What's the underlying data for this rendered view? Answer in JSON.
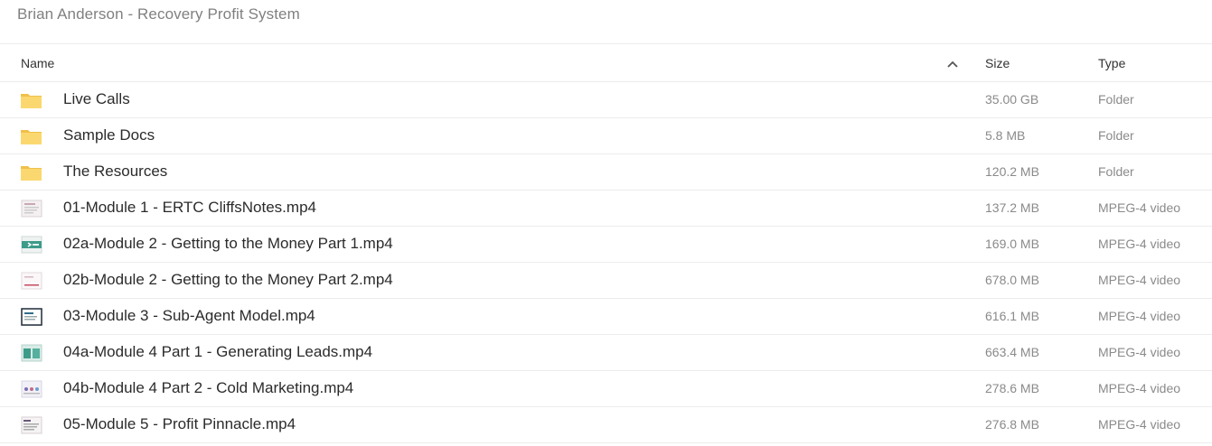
{
  "folder_title": "Brian Anderson - Recovery Profit System",
  "columns": {
    "name": "Name",
    "size": "Size",
    "type": "Type",
    "sort_icon": "chevron-up-icon"
  },
  "files": [
    {
      "name": "Live Calls",
      "size": "35.00 GB",
      "type": "Folder",
      "icon": "folder-icon"
    },
    {
      "name": "Sample Docs",
      "size": "5.8 MB",
      "type": "Folder",
      "icon": "folder-icon"
    },
    {
      "name": "The Resources",
      "size": "120.2 MB",
      "type": "Folder",
      "icon": "folder-icon"
    },
    {
      "name": "01-Module 1 - ERTC CliffsNotes.mp4",
      "size": "137.2 MB",
      "type": "MPEG-4 video",
      "icon": "video-thumbnail-icon"
    },
    {
      "name": "02a-Module 2 - Getting to the Money Part 1.mp4",
      "size": "169.0 MB",
      "type": "MPEG-4 video",
      "icon": "video-thumbnail-icon"
    },
    {
      "name": "02b-Module 2 - Getting to the Money Part 2.mp4",
      "size": "678.0 MB",
      "type": "MPEG-4 video",
      "icon": "video-thumbnail-icon"
    },
    {
      "name": "03-Module 3 - Sub-Agent Model.mp4",
      "size": "616.1 MB",
      "type": "MPEG-4 video",
      "icon": "video-thumbnail-icon"
    },
    {
      "name": "04a-Module 4 Part 1 - Generating Leads.mp4",
      "size": "663.4 MB",
      "type": "MPEG-4 video",
      "icon": "video-thumbnail-icon"
    },
    {
      "name": "04b-Module 4 Part 2 - Cold Marketing.mp4",
      "size": "278.6 MB",
      "type": "MPEG-4 video",
      "icon": "video-thumbnail-icon"
    },
    {
      "name": "05-Module 5 - Profit Pinnacle.mp4",
      "size": "276.8 MB",
      "type": "MPEG-4 video",
      "icon": "video-thumbnail-icon"
    }
  ],
  "colors": {
    "folder": "#f7d26b",
    "folder_dark": "#f0c04a",
    "divider": "#ececec"
  }
}
